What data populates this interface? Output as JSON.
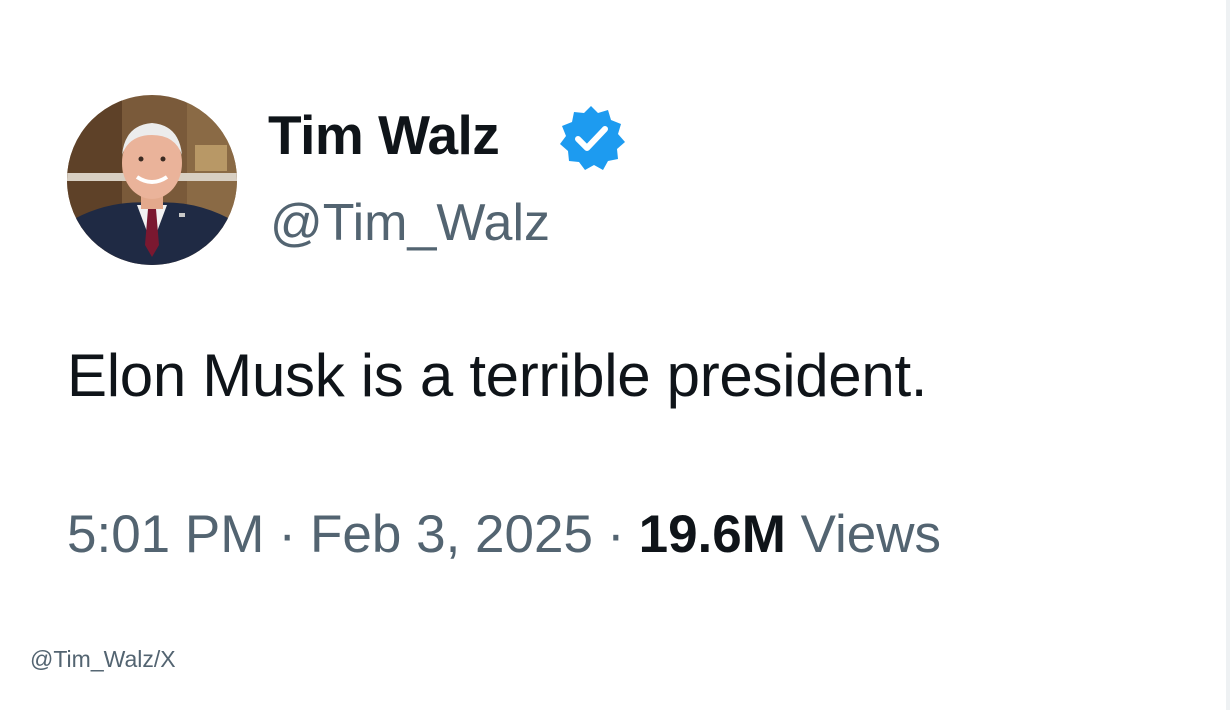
{
  "author": {
    "display_name": "Tim Walz",
    "handle": "@Tim_Walz",
    "verified": true,
    "verified_icon": "verified-badge-icon",
    "verified_color": "#1d9bf0"
  },
  "post": {
    "text": "Elon Musk is a terrible president."
  },
  "meta": {
    "time": "5:01 PM",
    "separator": "·",
    "date": "Feb 3, 2025",
    "views_count": "19.6M",
    "views_label": "Views"
  },
  "credit": "@Tim_Walz/X",
  "colors": {
    "text_primary": "#0f1419",
    "text_secondary": "#536471",
    "background": "#ffffff"
  }
}
